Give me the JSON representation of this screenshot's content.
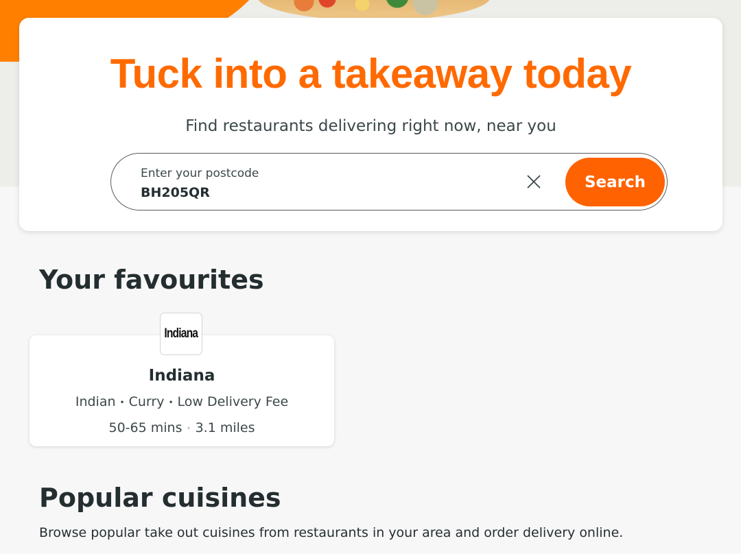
{
  "hero": {
    "title": "Tuck into a takeaway today",
    "subtitle": "Find restaurants delivering right now, near you"
  },
  "search": {
    "label": "Enter your postcode",
    "value": "BH205QR",
    "button_label": "Search",
    "clear_icon": "close-icon"
  },
  "favourites": {
    "heading": "Your favourites",
    "items": [
      {
        "logo_text": "Indiana",
        "name": "Indiana",
        "tags": [
          "Indian",
          "Curry",
          "Low Delivery Fee"
        ],
        "delivery_time": "50-65 mins",
        "distance": "3.1 miles"
      }
    ]
  },
  "cuisines": {
    "heading": "Popular cuisines",
    "description": "Browse popular take out cuisines from restaurants in your area and order delivery online."
  },
  "colors": {
    "brand_orange": "#ff6200",
    "title_orange": "#ff6a00",
    "text_dark": "#242e30"
  }
}
